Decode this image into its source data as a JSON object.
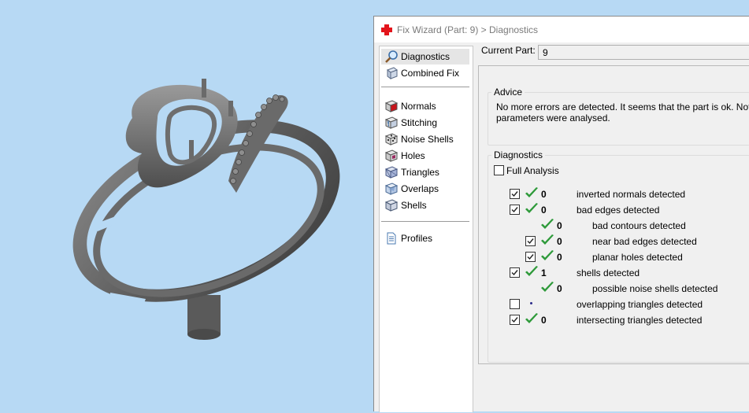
{
  "window": {
    "title": "Fix Wizard (Part: 9) > Diagnostics",
    "title_icon": "red-cross-icon"
  },
  "nav": {
    "items": [
      {
        "label": "Diagnostics",
        "icon": "magnifier-icon",
        "selected": true
      },
      {
        "label": "Combined Fix",
        "icon": "combined-fix-icon"
      },
      {
        "label": "Normals",
        "icon": "normals-cube-icon"
      },
      {
        "label": "Stitching",
        "icon": "stitching-cube-icon"
      },
      {
        "label": "Noise Shells",
        "icon": "noise-shells-icon"
      },
      {
        "label": "Holes",
        "icon": "holes-cube-icon"
      },
      {
        "label": "Triangles",
        "icon": "triangles-cube-icon"
      },
      {
        "label": "Overlaps",
        "icon": "overlaps-cube-icon"
      },
      {
        "label": "Shells",
        "icon": "shells-cube-icon"
      },
      {
        "label": "Profiles",
        "icon": "document-icon"
      }
    ]
  },
  "current_part": {
    "label": "Current Part:",
    "value": "9"
  },
  "advice": {
    "legend": "Advice",
    "line1": "No more errors are detected. It seems that the part is ok. Note t",
    "line2": "parameters were analysed."
  },
  "diagnostics": {
    "legend": "Diagnostics",
    "full_analysis_label": "Full Analysis",
    "full_analysis_checked": false,
    "rows": [
      {
        "checked": true,
        "status": "ok",
        "count": "0",
        "label": "inverted normals detected",
        "indent": 0
      },
      {
        "checked": true,
        "status": "ok",
        "count": "0",
        "label": "bad edges detected",
        "indent": 0
      },
      {
        "checked": null,
        "status": "ok",
        "count": "0",
        "label": "bad contours detected",
        "indent": 1
      },
      {
        "checked": true,
        "status": "ok",
        "count": "0",
        "label": "near bad edges detected",
        "indent": 1
      },
      {
        "checked": true,
        "status": "ok",
        "count": "0",
        "label": "planar holes detected",
        "indent": 1
      },
      {
        "checked": true,
        "status": "ok",
        "count": "1",
        "label": "shells detected",
        "indent": 0
      },
      {
        "checked": null,
        "status": "ok",
        "count": "0",
        "label": "possible noise shells detected",
        "indent": 1
      },
      {
        "checked": false,
        "status": "pending",
        "count": "",
        "label": "overlapping triangles detected",
        "indent": 0
      },
      {
        "checked": true,
        "status": "ok",
        "count": "0",
        "label": "intersecting triangles detected",
        "indent": 0
      }
    ]
  },
  "colors": {
    "viewport_bg": "#b7d9f4",
    "ok_check": "#2e9a3a",
    "model": "#5a5a5a"
  }
}
